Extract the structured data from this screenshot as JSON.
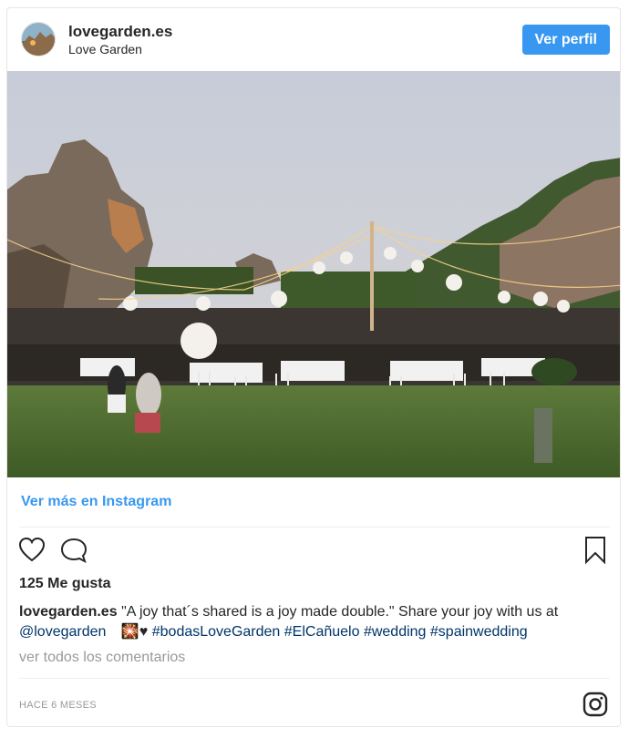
{
  "header": {
    "username": "lovegarden.es",
    "full_name": "Love Garden",
    "view_profile": "Ver perfil"
  },
  "post": {
    "view_more": "Ver más en Instagram",
    "likes": "125 Me gusta",
    "caption_username": "lovegarden.es",
    "caption_text": "\"A joy that´s shared is a joy made double.\" Share your joy with us at",
    "mention": "@lovegarden",
    "emoji": "🎇♥",
    "hashtags": [
      "#bodasLoveGarden",
      "#ElCañuelo",
      "#wedding",
      "#spainwedding"
    ],
    "view_comments": "ver todos los comentarios",
    "timestamp": "HACE 6 MESES"
  },
  "icons": {
    "like": "heart-icon",
    "comment": "comment-icon",
    "save": "bookmark-icon",
    "brand": "instagram-icon"
  },
  "colors": {
    "accent": "#3897f0",
    "link": "#003569",
    "muted": "#999999"
  }
}
